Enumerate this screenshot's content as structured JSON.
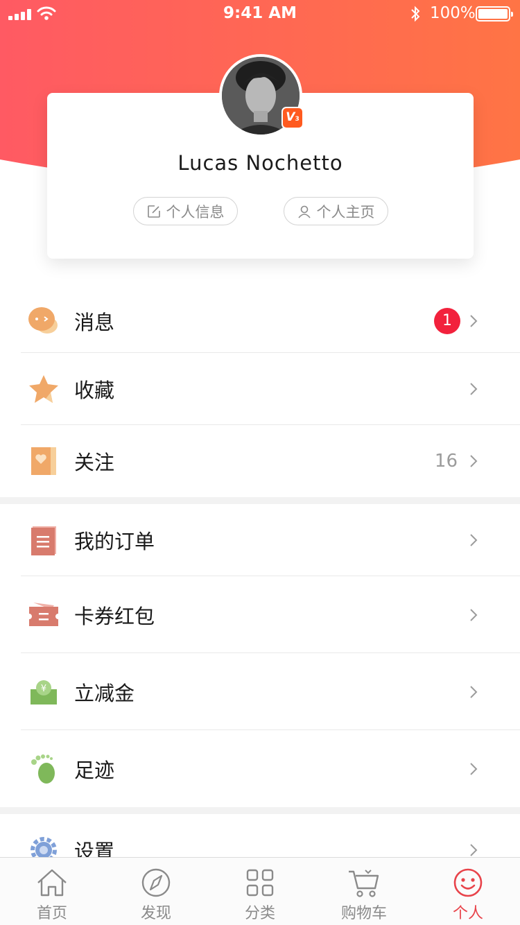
{
  "status_bar": {
    "time": "9:41 AM",
    "battery": "100%"
  },
  "colors": {
    "gradient_start": "#ff5e63",
    "gradient_end": "#ff7a45",
    "accent": "#e8434a",
    "badge": "#f2213c"
  },
  "profile": {
    "name": "Lucas Nochetto",
    "level_badge": "V",
    "level_number": "3",
    "buttons": {
      "info": "个人信息",
      "homepage": "个人主页"
    }
  },
  "menu": {
    "messages": {
      "label": "消息",
      "badge": "1",
      "icon": "chat-bubble-icon"
    },
    "favorites": {
      "label": "收藏",
      "icon": "star-icon"
    },
    "following": {
      "label": "关注",
      "count": "16",
      "icon": "heart-bookmark-icon"
    },
    "orders": {
      "label": "我的订单",
      "icon": "order-list-icon"
    },
    "coupons": {
      "label": "卡券红包",
      "icon": "ticket-icon"
    },
    "discount": {
      "label": "立减金",
      "icon": "yuan-wallet-icon"
    },
    "footprints": {
      "label": "足迹",
      "icon": "footprint-icon"
    },
    "settings": {
      "label": "设置",
      "icon": "gear-icon"
    }
  },
  "tabbar": {
    "home": "首页",
    "discover": "发现",
    "category": "分类",
    "cart": "购物车",
    "profile": "个人"
  }
}
